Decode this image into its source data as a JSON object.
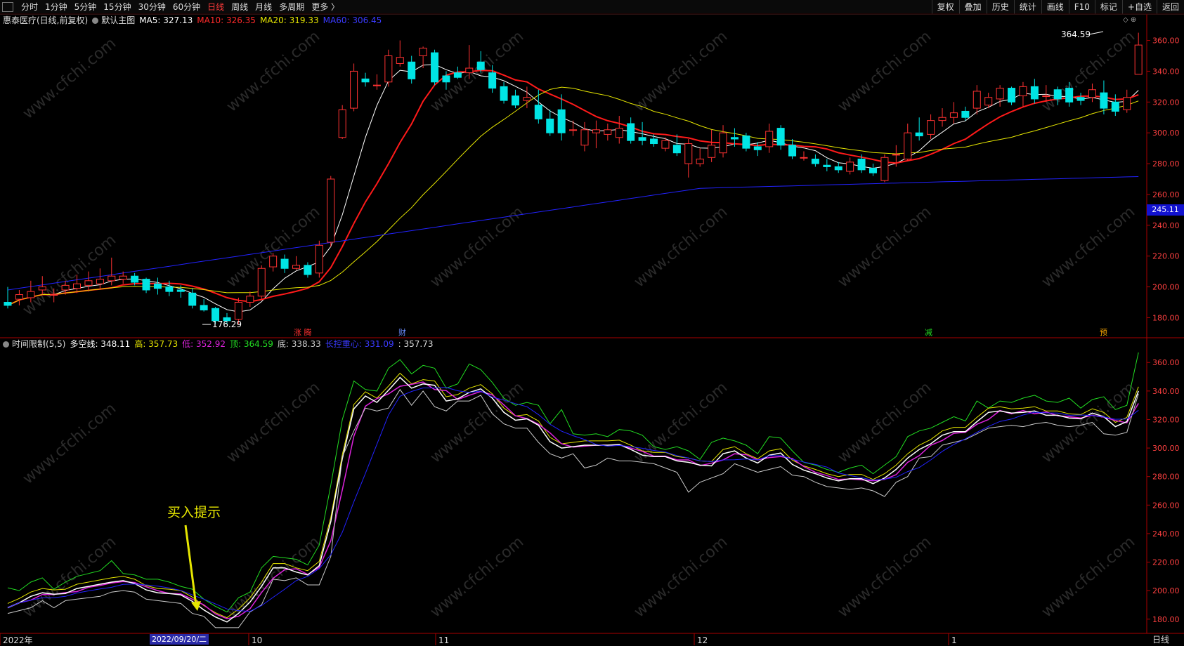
{
  "toolbar": {
    "left_items": [
      "分时",
      "1分钟",
      "5分钟",
      "15分钟",
      "30分钟",
      "60分钟",
      "日线",
      "周线",
      "月线",
      "多周期",
      "更多 〉"
    ],
    "active": "日线",
    "right_items": [
      "复权",
      "叠加",
      "历史",
      "统计",
      "画线",
      "F10",
      "标记",
      "+自选",
      "返回"
    ]
  },
  "main_legend": {
    "title": "惠泰医疗(日线,前复权)",
    "chart_name": "默认主图",
    "ma5": "MA5: 327.13",
    "ma10": "MA10: 326.35",
    "ma20": "MA20: 319.33",
    "ma60": "MA60: 306.45"
  },
  "indicator_legend": {
    "name": "时间限制(5,5)",
    "duokong": "多空线: 348.11",
    "high": "高: 357.73",
    "low": "低: 352.92",
    "top": "顶: 364.59",
    "bottom": "底: 338.33",
    "center": "长控重心: 331.09",
    "last": ": 357.73"
  },
  "annotations": {
    "max_label": "364.59",
    "min_label": "176.29",
    "current_price": "245.11",
    "buy_hint": "买入提示",
    "event_zhangting": "涨 腾",
    "event_cai": "财",
    "event_jian": "减",
    "event_yu": "预"
  },
  "x_axis": {
    "labels": [
      "2022年",
      "10",
      "11",
      "12",
      "1"
    ],
    "cursor_date": "2022/09/20/二",
    "period": "日线"
  },
  "main_axis_ticks": [
    "360.00",
    "340.00",
    "320.00",
    "300.00",
    "280.00",
    "260.00",
    "240.00",
    "220.00",
    "200.00",
    "180.00"
  ],
  "ind_axis_ticks": [
    "360.00",
    "340.00",
    "320.00",
    "300.00",
    "280.00",
    "260.00",
    "240.00",
    "220.00",
    "200.00",
    "180.00"
  ],
  "watermark": "www.cfchi.com",
  "colors": {
    "up": "#ff3232",
    "down": "#00e5e5",
    "ma5": "#ffffff",
    "ma10": "#ff1a1a",
    "ma20": "#e6e600",
    "ma60": "#2222ff",
    "axis": "#aa0000",
    "ind_top": "#22dd22",
    "ind_high": "#e6e600",
    "ind_low": "#dd22dd",
    "ind_duokong": "#ffffff",
    "ind_center": "#2222ff",
    "ind_bottom": "#cccccc"
  },
  "chart_data": {
    "type": "candlestick",
    "price_range": [
      172,
      368
    ],
    "candles": [
      [
        190,
        188,
        200,
        186
      ],
      [
        192,
        195,
        198,
        188
      ],
      [
        193,
        197,
        204,
        190
      ],
      [
        198,
        200,
        207,
        195
      ],
      [
        195,
        195,
        199,
        190
      ],
      [
        198,
        201,
        204,
        195
      ],
      [
        199,
        202,
        208,
        196
      ],
      [
        201,
        204,
        210,
        197
      ],
      [
        202,
        205,
        212,
        198
      ],
      [
        204,
        207,
        219,
        201
      ],
      [
        205,
        207,
        210,
        202
      ],
      [
        207,
        203,
        209,
        201
      ],
      [
        205,
        198,
        206,
        196
      ],
      [
        202,
        199,
        206,
        195
      ],
      [
        200,
        197,
        204,
        194
      ],
      [
        198,
        197,
        201,
        193
      ],
      [
        196,
        188,
        199,
        186
      ],
      [
        188,
        185,
        192,
        184
      ],
      [
        186,
        178,
        187,
        176
      ],
      [
        180,
        178,
        183,
        176
      ],
      [
        179,
        190,
        193,
        176
      ],
      [
        190,
        194,
        197,
        187
      ],
      [
        194,
        212,
        214,
        192
      ],
      [
        213,
        220,
        222,
        210
      ],
      [
        218,
        212,
        221,
        209
      ],
      [
        212,
        214,
        220,
        211
      ],
      [
        214,
        208,
        216,
        206
      ],
      [
        209,
        227,
        230,
        206
      ],
      [
        229,
        270,
        272,
        226
      ],
      [
        297,
        315,
        318,
        296
      ],
      [
        316,
        340,
        345,
        314
      ],
      [
        335,
        333,
        339,
        330
      ],
      [
        331,
        331,
        338,
        328
      ],
      [
        333,
        350,
        354,
        330
      ],
      [
        345,
        349,
        360,
        343
      ],
      [
        346,
        335,
        350,
        332
      ],
      [
        350,
        355,
        356,
        342
      ],
      [
        352,
        333,
        354,
        331
      ],
      [
        337,
        333,
        340,
        328
      ],
      [
        339,
        336,
        343,
        335
      ],
      [
        339,
        342,
        357,
        335
      ],
      [
        346,
        341,
        353,
        339
      ],
      [
        339,
        329,
        344,
        326
      ],
      [
        330,
        321,
        333,
        319
      ],
      [
        324,
        318,
        328,
        316
      ],
      [
        321,
        323,
        330,
        316
      ],
      [
        318,
        309,
        328,
        306
      ],
      [
        309,
        300,
        315,
        298
      ],
      [
        315,
        300,
        325,
        295
      ],
      [
        302,
        302,
        308,
        298
      ],
      [
        292,
        302,
        307,
        288
      ],
      [
        300,
        302,
        308,
        290
      ],
      [
        299,
        302,
        306,
        295
      ],
      [
        297,
        303,
        311,
        293
      ],
      [
        306,
        295,
        310,
        293
      ],
      [
        297,
        295,
        307,
        292
      ],
      [
        296,
        293,
        299,
        291
      ],
      [
        290,
        295,
        297,
        288
      ],
      [
        292,
        287,
        299,
        285
      ],
      [
        280,
        293,
        296,
        271
      ],
      [
        280,
        283,
        290,
        278
      ],
      [
        284,
        292,
        302,
        281
      ],
      [
        287,
        300,
        305,
        284
      ],
      [
        297,
        296,
        303,
        291
      ],
      [
        298,
        290,
        300,
        288
      ],
      [
        291,
        289,
        294,
        285
      ],
      [
        291,
        301,
        306,
        287
      ],
      [
        303,
        292,
        305,
        289
      ],
      [
        292,
        285,
        296,
        283
      ],
      [
        284,
        284,
        288,
        282
      ],
      [
        283,
        280,
        286,
        278
      ],
      [
        279,
        278,
        283,
        275
      ],
      [
        278,
        276,
        281,
        274
      ],
      [
        275,
        281,
        284,
        273
      ],
      [
        283,
        276,
        286,
        274
      ],
      [
        277,
        274,
        280,
        272
      ],
      [
        269,
        284,
        286,
        268
      ],
      [
        286,
        286,
        292,
        278
      ],
      [
        283,
        300,
        306,
        282
      ],
      [
        300,
        298,
        310,
        295
      ],
      [
        299,
        308,
        312,
        296
      ],
      [
        308,
        310,
        316,
        304
      ],
      [
        310,
        313,
        320,
        306
      ],
      [
        314,
        310,
        317,
        308
      ],
      [
        316,
        327,
        331,
        312
      ],
      [
        318,
        323,
        326,
        316
      ],
      [
        322,
        329,
        331,
        317
      ],
      [
        329,
        320,
        330,
        318
      ],
      [
        324,
        330,
        333,
        317
      ],
      [
        330,
        322,
        335,
        319
      ],
      [
        324,
        324,
        331,
        320
      ],
      [
        328,
        322,
        330,
        318
      ],
      [
        329,
        320,
        333,
        317
      ],
      [
        323,
        321,
        326,
        318
      ],
      [
        323,
        328,
        332,
        320
      ],
      [
        326,
        316,
        334,
        312
      ],
      [
        320,
        314,
        325,
        311
      ],
      [
        315,
        323,
        328,
        313
      ],
      [
        338,
        357,
        365,
        340
      ]
    ],
    "ma5_line": "white",
    "ma10_line": "red",
    "ma20_line": "yellow",
    "ma60_line": "blue",
    "indicator_range": [
      172,
      368
    ]
  }
}
